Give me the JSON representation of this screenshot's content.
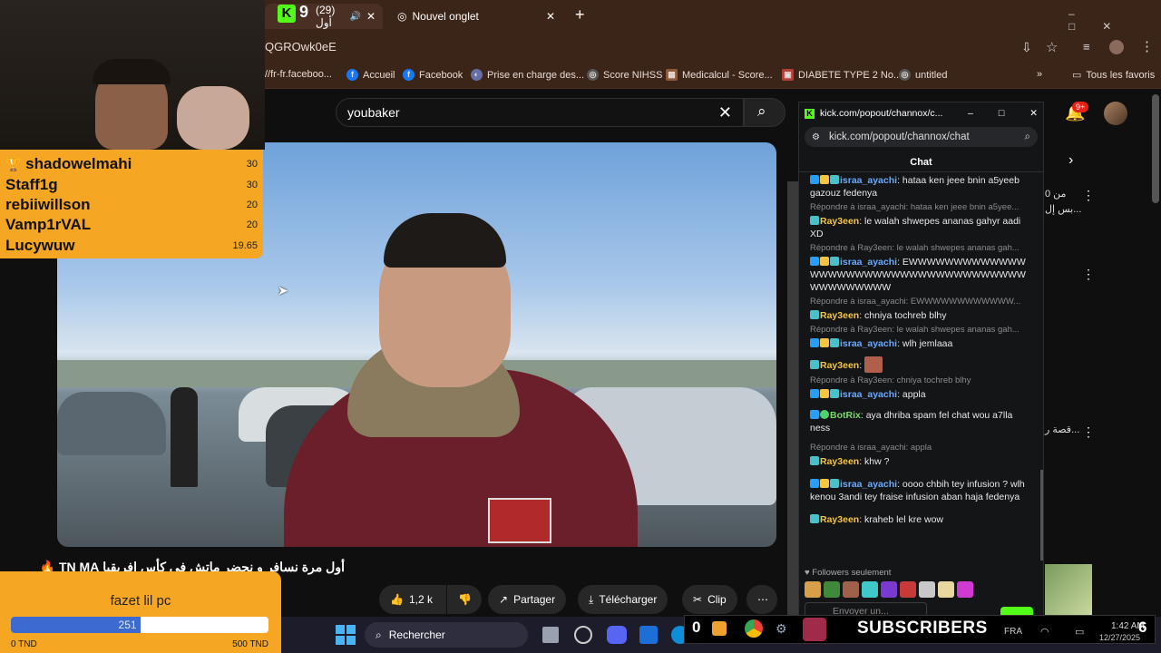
{
  "browser": {
    "tabs": [
      {
        "title": "(29) أول"
      },
      {
        "title": "Nouvel onglet"
      }
    ],
    "url_fragment": "QGROwk0eE",
    "bookmarks": [
      "//fr-fr.faceboo...",
      "Accueil",
      "Facebook",
      "Prise en charge des...",
      "Score NIHSS",
      "Medicalcul - Score...",
      "DIABETE TYPE 2 No...",
      "untitled"
    ],
    "all_favorites": "Tous les favoris",
    "tab_counter": "9"
  },
  "youtube": {
    "search_value": "youbaker",
    "notification_count": "9+",
    "video_title": "أول مرة نسافر و نحضر ماتش في كأس افريقيا TN MA 🔥",
    "like_count": "1,2 k",
    "actions": {
      "share": "Partager",
      "download": "Télécharger",
      "clip": "Clip"
    },
    "sidebar_text": [
      "من 0",
      "بس إل...",
      "قصة ر..."
    ]
  },
  "leaderboard": {
    "entries": [
      {
        "name": "shadowelmahi",
        "value": "30",
        "trophy": true
      },
      {
        "name": "Staff1g",
        "value": "30"
      },
      {
        "name": "rebiiwillson",
        "value": "20"
      },
      {
        "name": "Vamp1rVAL",
        "value": "20"
      },
      {
        "name": "Lucywuw",
        "value": "19.65"
      }
    ]
  },
  "goal": {
    "title": "fazet lil pc",
    "current": "251",
    "progress_fraction": 0.502,
    "min_label": "0 TND",
    "max_label": "500 TND"
  },
  "kick": {
    "window_title": "kick.com/popout/channox/c...",
    "address": "kick.com/popout/channox/chat",
    "header": "Chat",
    "followers_only": "Followers seulement",
    "send_placeholder": "Envoyer un...",
    "messages": [
      {
        "user": "israa_ayachi",
        "color": "u1",
        "text": "hataa ken jeee bnin a5yeeb gazouz fedenya"
      },
      {
        "reply": "Répondre à israa_ayachi: hataa ken jeee bnin a5yee...",
        "user": "Ray3een",
        "color": "u2",
        "text": "le walah shwepes ananas gahyr aadi XD"
      },
      {
        "reply": "Répondre à Ray3een: le walah shwepes ananas gah...",
        "user": "israa_ayachi",
        "color": "u1",
        "text": "EWWWWWWWWWWWWWWWWWWWWWWWWWWWWWWWWWWWWWWWWWWWWWW"
      },
      {
        "reply": "Répondre à israa_ayachi: EWWWWWWWWWWWW...",
        "user": "Ray3een",
        "color": "u2",
        "text": "chniya tochreb blhy"
      },
      {
        "reply": "Répondre à Ray3een: le walah shwepes ananas gah...",
        "user": "israa_ayachi",
        "color": "u1",
        "text": "wlh jemlaaa"
      },
      {
        "user": "Ray3een",
        "color": "u2",
        "text": ""
      },
      {
        "reply": "Répondre à Ray3een: chniya tochreb blhy",
        "user": "israa_ayachi",
        "color": "u1",
        "text": "appla"
      },
      {
        "user": "BotRix",
        "color": "u3",
        "text": "aya dhriba spam fel chat wou a7lla ness"
      },
      {
        "reply": "Répondre à israa_ayachi: appla",
        "user": "Ray3een",
        "color": "u2",
        "text": "khw ?"
      },
      {
        "user": "israa_ayachi",
        "color": "u1",
        "text": "oooo chbih tey infusion ? wlh kenou 3andi tey fraise infusion aban haja fedenya"
      },
      {
        "user": "Ray3een",
        "color": "u2",
        "text": "kraheb lel kre wow"
      }
    ]
  },
  "taskbar": {
    "search": "Rechercher",
    "lang": "FRA",
    "time": "1:42 AM",
    "date": "12/27/2025"
  },
  "overlay": {
    "subscribers_label": "SUBSCRIBERS",
    "left_count": "0",
    "right_count": "6"
  }
}
